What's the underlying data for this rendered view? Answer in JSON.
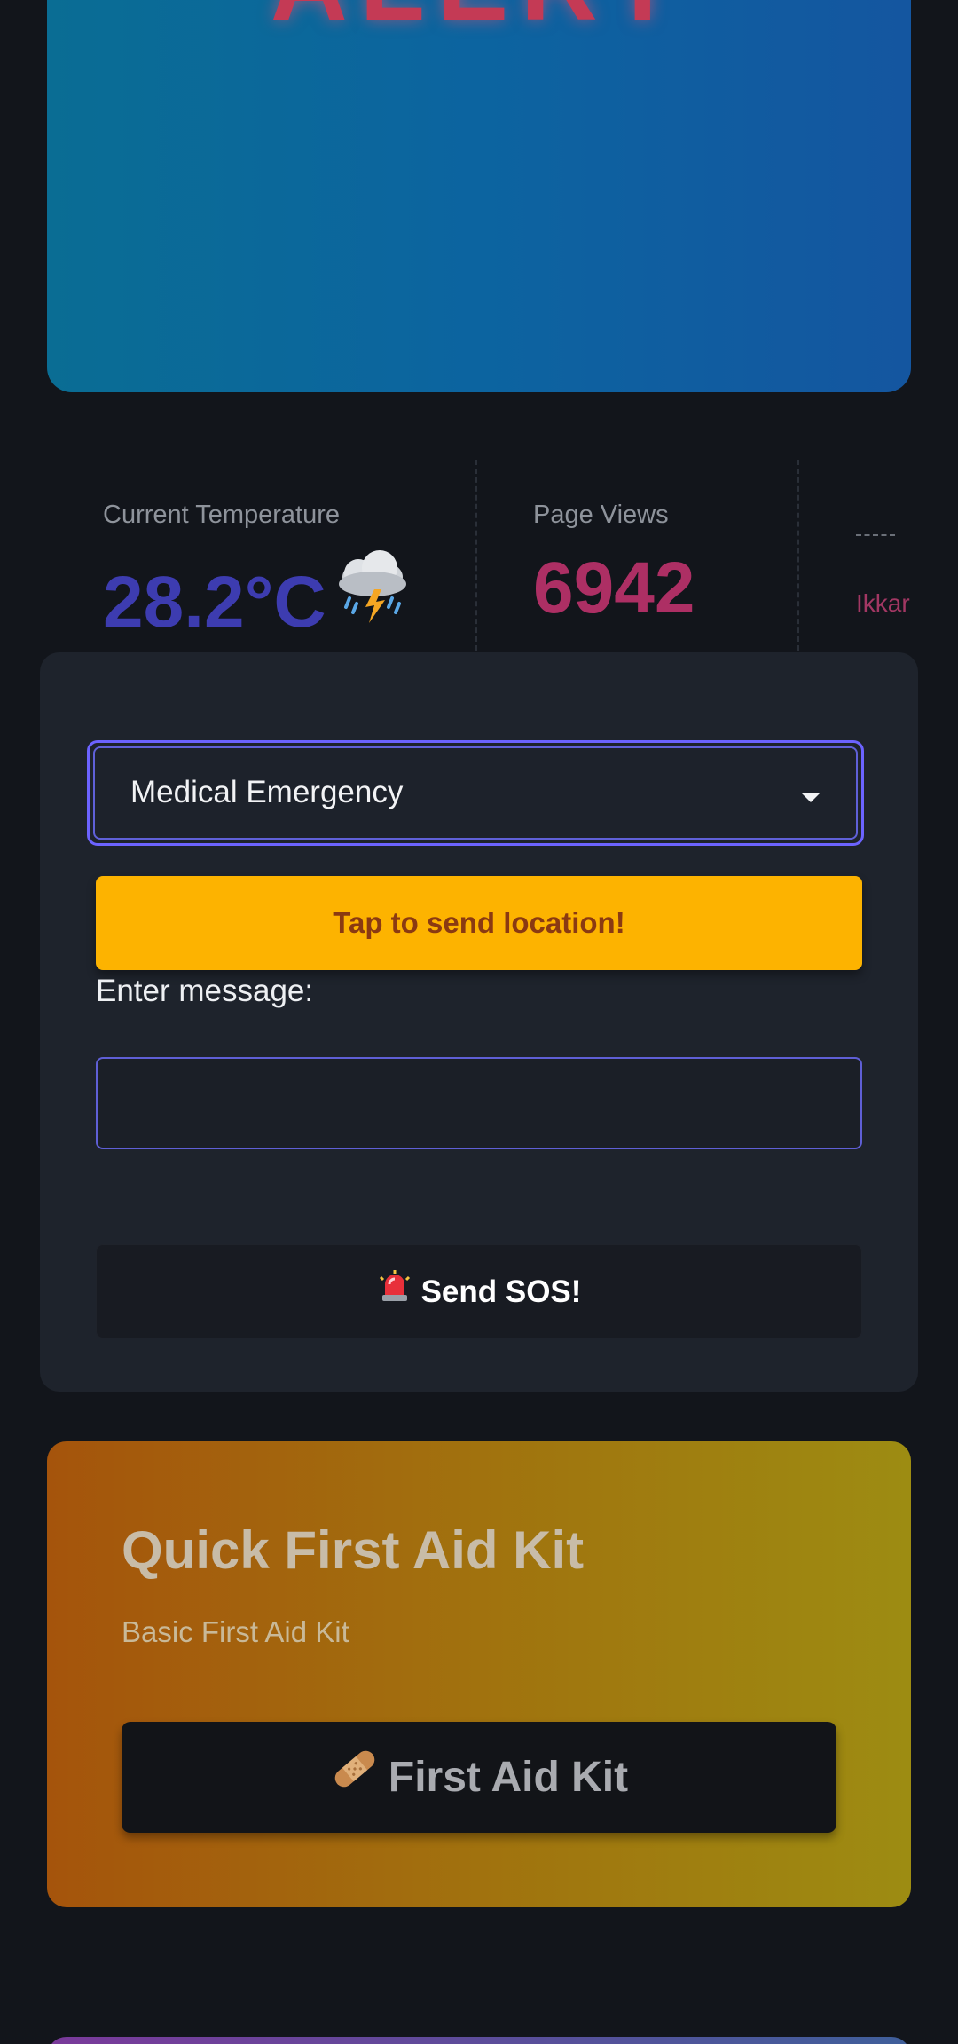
{
  "hero": {
    "title": "ALERT"
  },
  "stats": {
    "temperature": {
      "label": "Current Temperature",
      "value": "28.2°C",
      "icon": "thunderstorm-icon"
    },
    "views": {
      "label": "Page Views",
      "value": "6942"
    },
    "third": {
      "text": "Ikkar"
    }
  },
  "form": {
    "emergency_type": "Medical Emergency",
    "location_button": "Tap to send location!",
    "message_label": "Enter message:",
    "message_value": "",
    "sos_button": "Send SOS!",
    "sos_icon": "siren-icon"
  },
  "first_aid": {
    "title": "Quick First Aid Kit",
    "subtitle": "Basic First Aid Kit",
    "button": "First Aid Kit",
    "button_icon": "bandage-icon"
  },
  "colors": {
    "background": "#12151b",
    "accent": "#6c63ff",
    "location_button": "#fdb300",
    "temperature_value": "#3d3cb0",
    "views_value": "#ad2f64"
  }
}
